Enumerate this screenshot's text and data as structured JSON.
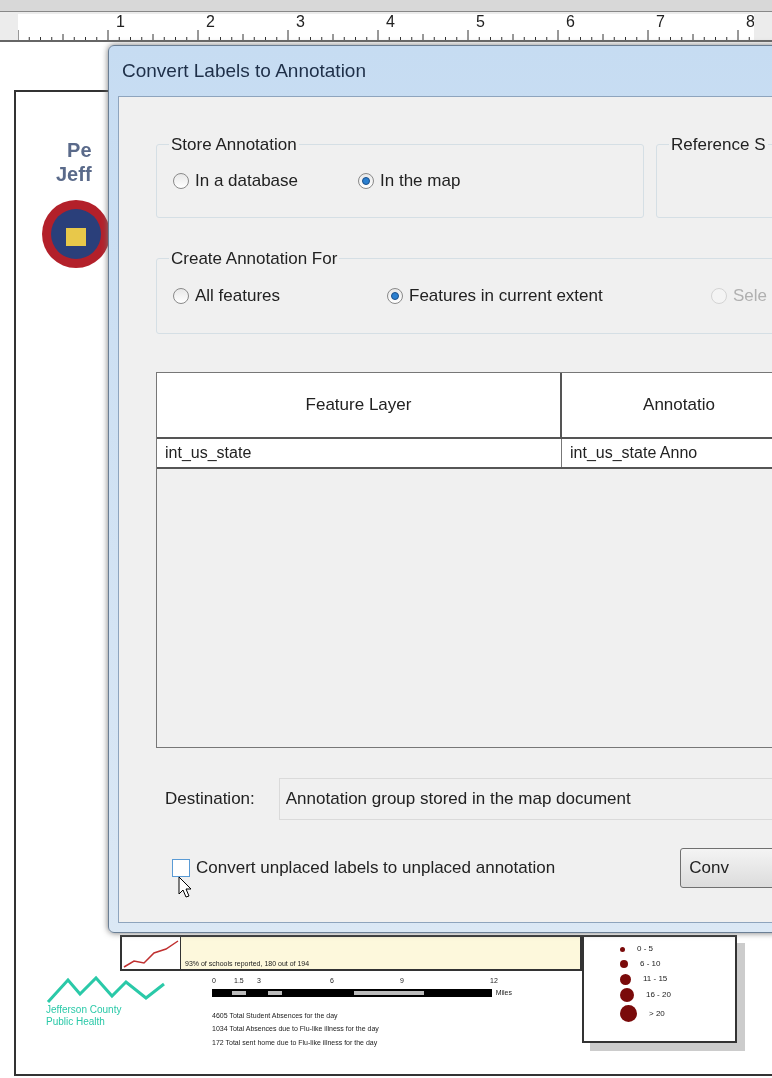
{
  "ruler": {
    "labels": [
      "1",
      "2",
      "3",
      "4",
      "5",
      "6",
      "7",
      "8"
    ]
  },
  "map_page": {
    "title_lines": [
      "Pe",
      "Jeff"
    ],
    "chart_caption": "93% of schools reported, 180 out of 194",
    "scale_labels": [
      "0",
      "1.5",
      "3",
      "6",
      "9",
      "12"
    ],
    "scale_unit": "Miles",
    "logo_lines": [
      "Jefferson County",
      "Public Health"
    ],
    "summary_lines": [
      "4605 Total Student Absences for the day",
      "1034 Total Absences due to Flu-like illness for the day",
      "172 Total sent home due to Flu-like illness for the day"
    ],
    "legend": [
      "0 - 5",
      "6 - 10",
      "11 - 15",
      "16 - 20",
      "> 20"
    ]
  },
  "dialog": {
    "title": "Convert Labels to Annotation",
    "store_group": {
      "title": "Store Annotation",
      "options": [
        {
          "label": "In a database",
          "selected": false,
          "disabled": false
        },
        {
          "label": "In the map",
          "selected": true,
          "disabled": false
        }
      ]
    },
    "reference_group": {
      "title": "Reference S"
    },
    "create_group": {
      "title": "Create Annotation For",
      "options": [
        {
          "label": "All features",
          "selected": false,
          "disabled": false
        },
        {
          "label": "Features in current extent",
          "selected": true,
          "disabled": false
        },
        {
          "label": "Sele",
          "selected": false,
          "disabled": true
        }
      ]
    },
    "table": {
      "columns": [
        "Feature Layer",
        "Annotatio"
      ],
      "rows": [
        [
          "int_us_state",
          "int_us_state Anno"
        ]
      ]
    },
    "destination": {
      "label": "Destination:",
      "value": "Annotation group stored in the map document"
    },
    "unplaced": {
      "label": "Convert unplaced labels to unplaced annotation",
      "checked": false
    },
    "convert_button": "Conv"
  }
}
